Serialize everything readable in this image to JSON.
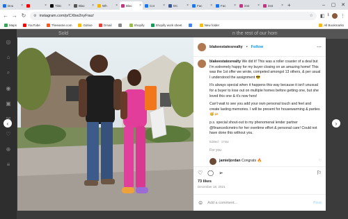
{
  "tabs": [
    {
      "label": "Dou",
      "color": "#1a73e8"
    },
    {
      "label": "",
      "color": "#ff0000"
    },
    {
      "label": "Tiktc",
      "color": "#000000"
    },
    {
      "label": "Blac",
      "color": "#555555"
    },
    {
      "label": "Wh",
      "color": "#f4b400"
    },
    {
      "label": "Blac",
      "color": "#c13584"
    },
    {
      "label": "Cor",
      "color": "#1877f2"
    },
    {
      "label": "DC",
      "color": "#3b5998"
    },
    {
      "label": "Fac",
      "color": "#1877f2"
    },
    {
      "label": "Fac",
      "color": "#1877f2"
    },
    {
      "label": "inst",
      "color": "#c13584"
    },
    {
      "label": "inst",
      "color": "#c13584"
    }
  ],
  "active_tab_index": 5,
  "address": {
    "url": "instagram.com/p/CXbw2nyFraz/"
  },
  "bookmarks": [
    {
      "label": "Maps",
      "color": "#34a853"
    },
    {
      "label": "YouTube",
      "color": "#ff0000"
    },
    {
      "label": "Theeasne.com",
      "color": "#ff5722"
    },
    {
      "label": "Gdrive",
      "color": "#fbbc04"
    },
    {
      "label": "Gmail",
      "color": "#ea4335"
    },
    {
      "label": "",
      "color": "#888888"
    },
    {
      "label": "Shopify",
      "color": "#95bf47"
    },
    {
      "label": "Shopify work sheet",
      "color": "#0f9d58"
    },
    {
      "label": "",
      "color": "#4285f4"
    },
    {
      "label": "New folder",
      "color": "#fbbc04"
    }
  ],
  "bookmarks_all": "All Bookmarks",
  "background": {
    "left": "Sold",
    "right": "n the rest of our hom"
  },
  "post": {
    "username": "blakeestatesrealty",
    "follow": "Follow",
    "caption_p1": "We did it! This was a roller coaster of a deal but I'm extremely happy for my buyer closing on an amazing home! This was the 1st offer we wrote, competed amongst 13 others, & per usual I understood the assignment 😎",
    "caption_p2": "It's always special when it happens this way because it isn't unusual for a buyer to lose out on multiple homes before getting one, but she loved this one & it's now hers!",
    "caption_p3": "Can't wait to see you add your own personal touch and feel and create lasting memories. I will be present for housewarming & parties 🥳🍻",
    "caption_p4": "p.s. special shout-out to my phenomenal lender partner @financedcmetro for her overtime effort & personal care! Could not have done this without you.",
    "edited": "Edited · 174w",
    "for_you": "For you",
    "comment_user": "jamieljordan",
    "comment_text": "Congrats 🔥",
    "likes": "73 likes",
    "date": "December 18, 2021",
    "comment_placeholder": "Add a comment...",
    "post_button": "Post"
  }
}
